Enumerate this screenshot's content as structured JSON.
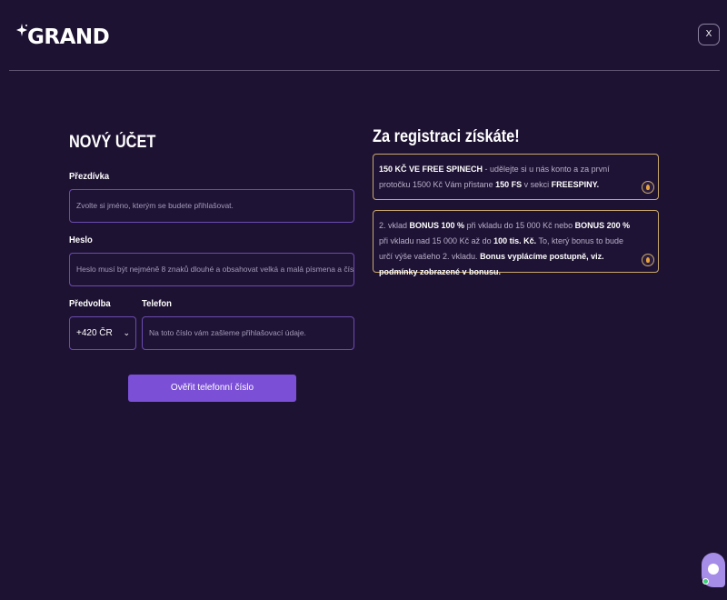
{
  "header": {
    "logo_text": "GRAND",
    "close_label": "X"
  },
  "form": {
    "title": "NOVÝ ÚČET",
    "nickname_label": "Přezdívka",
    "nickname_placeholder": "Zvolte si jméno, kterým se budete přihlašovat.",
    "password_label": "Heslo",
    "password_placeholder": "Heslo musí být nejméně 8 znaků dlouhé a obsahovat velká a malá písmena a číslo.",
    "prefix_label": "Předvolba",
    "prefix_value": "+420 ČR",
    "phone_label": "Telefon",
    "phone_placeholder": "Na toto číslo vám zašleme přihlašovací údaje.",
    "verify_button": "Ověřit telefonní číslo"
  },
  "bonus": {
    "title": "Za registraci získáte!",
    "card1": {
      "b1": "150 KČ VE FREE SPINECH",
      "t1": " - udělejte si u nás konto a za první protočku 1500 Kč Vám přistane ",
      "b2": "150 FS",
      "t2": " v sekci ",
      "b3": "FREESPINY."
    },
    "card2": {
      "t1": "2. vklad ",
      "b1": "BONUS 100 %",
      "t2": " při vkladu do 15 000 Kč nebo ",
      "b2": "BONUS 200 %",
      "t3": " při vkladu nad 15 000 Kč až do ",
      "b3": "100 tis. Kč.",
      "t4": " To, který bonus to bude určí výše vašeho 2. vkladu. ",
      "b4": "Bonus vyplácíme postupně,",
      "t5": " ",
      "b5": "viz. podmínky zobrazené v bonusu."
    }
  },
  "icons": {
    "sparkle": "sparkle-icon",
    "chevron": "chevron-down-icon",
    "bonus": "flame-icon",
    "chat": "chat-icon"
  },
  "colors": {
    "background": "#1e1233",
    "accent": "#7b4fd6",
    "input_border": "#6a4bb0",
    "card_border": "#c9a86a"
  }
}
